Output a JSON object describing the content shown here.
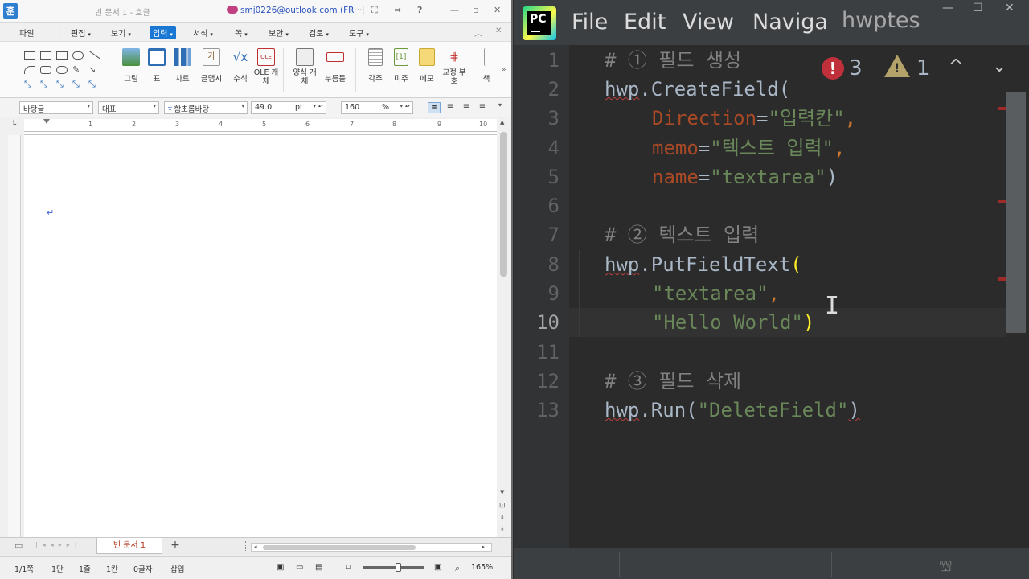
{
  "hwp": {
    "logo": "훈",
    "doc_title": "빈 문서 1 - 호글",
    "account": "smj0226@outlook.com (FR···",
    "menus": [
      "파일",
      "편집",
      "보기",
      "입력",
      "서식",
      "쪽",
      "보안",
      "검토",
      "도구"
    ],
    "active_menu_index": 3,
    "ribbon": {
      "picture": "그림",
      "table": "표",
      "chart": "차트",
      "font_art": "글맵시",
      "equation": "수식",
      "ole": "OLE 개체",
      "form": "양식 개체",
      "button": "누름틀",
      "footnote": "각주",
      "endnote": "미주",
      "memo": "메모",
      "proof": "교정 부호",
      "more": "책"
    },
    "format": {
      "style": "바탕글",
      "font_lang": "대표",
      "font_name": "함초롬바탕",
      "font_size": "49.0",
      "font_unit": "pt",
      "line_spacing": "160",
      "line_unit": "%"
    },
    "ruler_numbers": [
      "1",
      "2",
      "3",
      "4",
      "5",
      "6",
      "7",
      "8",
      "9",
      "10"
    ],
    "paragraph_mark": "↵",
    "doc_tab": "빈 문서 1",
    "add_tab": "+",
    "status": {
      "page": "1/1쪽",
      "section": "1단",
      "line": "1줄",
      "col": "1칸",
      "chars": "0글자",
      "mode": "삽입",
      "zoom": "165%",
      "zoom_level_pct": 55
    }
  },
  "pycharm": {
    "menus": [
      "File",
      "Edit",
      "View",
      "Naviga"
    ],
    "project": "hwptes",
    "inspections": {
      "errors": "3",
      "warnings": "1",
      "error_icon": "!",
      "warning_icon": "!"
    },
    "nav_up": "^",
    "nav_down": "⌄",
    "line_numbers": [
      "1",
      "2",
      "3",
      "4",
      "5",
      "6",
      "7",
      "8",
      "9",
      "10",
      "11",
      "12",
      "13"
    ],
    "current_line": "10",
    "code": {
      "l1": "# ① 필드 생성",
      "l2_obj": "hwp",
      "l2_rest": ".CreateField(",
      "l3_param": "Direction",
      "l3_eq": "=",
      "l3_str": "\"입력칸\"",
      "l3_comma": ",",
      "l4_param": "memo",
      "l4_eq": "=",
      "l4_str": "\"텍스트 입력\"",
      "l4_comma": ",",
      "l5_param": "name",
      "l5_eq": "=",
      "l5_str": "\"textarea\"",
      "l5_close": ")",
      "l7": "# ② 텍스트 입력",
      "l8_obj": "hwp",
      "l8_rest": ".PutFieldText",
      "l8_paren": "(",
      "l9_str": "\"textarea\"",
      "l9_comma": ",",
      "l10_str": "\"Hello World\"",
      "l10_paren": ")",
      "l12": "# ③ 필드 삭제",
      "l13_obj": "hwp",
      "l13_rest": ".Run(",
      "l13_str": "\"DeleteField\"",
      "l13_close": ")"
    },
    "text_cursor": "I"
  },
  "colors": {
    "pycharm_bg": "#2b2b2b",
    "comment": "#808080",
    "string": "#6a8759",
    "keyword_comma": "#cc7832",
    "param": "#aa4926",
    "error": "#c0303a",
    "hwp_active_menu": "#1976d2"
  }
}
